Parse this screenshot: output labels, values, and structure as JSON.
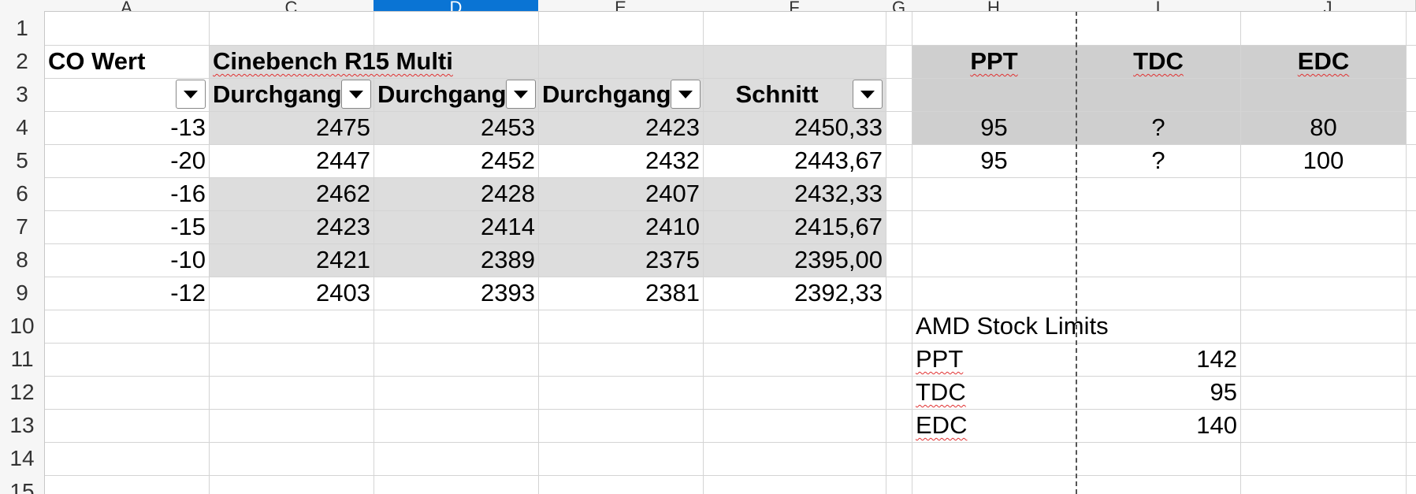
{
  "columns": [
    "A",
    "C",
    "D",
    "E",
    "F",
    "G",
    "H",
    "I",
    "J"
  ],
  "rows": [
    "1",
    "2",
    "3",
    "4",
    "5",
    "6",
    "7",
    "8",
    "9",
    "10",
    "11",
    "12",
    "13",
    "14",
    "15"
  ],
  "table": {
    "co_header": "CO Wert",
    "cinebench_header": "Cinebench R15 Multi",
    "sub_headers": [
      "Durchgang",
      "Durchgang",
      "Durchgang",
      "Schnitt"
    ],
    "rows": [
      {
        "co": "-13",
        "d1": "2475",
        "d2": "2453",
        "d3": "2423",
        "avg": "2450,33"
      },
      {
        "co": "-20",
        "d1": "2447",
        "d2": "2452",
        "d3": "2432",
        "avg": "2443,67"
      },
      {
        "co": "-16",
        "d1": "2462",
        "d2": "2428",
        "d3": "2407",
        "avg": "2432,33"
      },
      {
        "co": "-15",
        "d1": "2423",
        "d2": "2414",
        "d3": "2410",
        "avg": "2415,67"
      },
      {
        "co": "-10",
        "d1": "2421",
        "d2": "2389",
        "d3": "2375",
        "avg": "2395,00"
      },
      {
        "co": "-12",
        "d1": "2403",
        "d2": "2393",
        "d3": "2381",
        "avg": "2392,33"
      }
    ]
  },
  "limits_table": {
    "headers": [
      "PPT",
      "TDC",
      "EDC"
    ],
    "rows": [
      {
        "ppt": "95",
        "tdc": "?",
        "edc": "80"
      },
      {
        "ppt": "95",
        "tdc": "?",
        "edc": "100"
      }
    ]
  },
  "stock_limits": {
    "title": "AMD Stock Limits",
    "items": [
      {
        "label": "PPT",
        "value": "142"
      },
      {
        "label": "TDC",
        "value": "95"
      },
      {
        "label": "EDC",
        "value": "140"
      }
    ]
  },
  "colors": {
    "selected_column": "#0a74d4",
    "band_fill": "#dddddd",
    "grid": "#d4d4d4"
  }
}
